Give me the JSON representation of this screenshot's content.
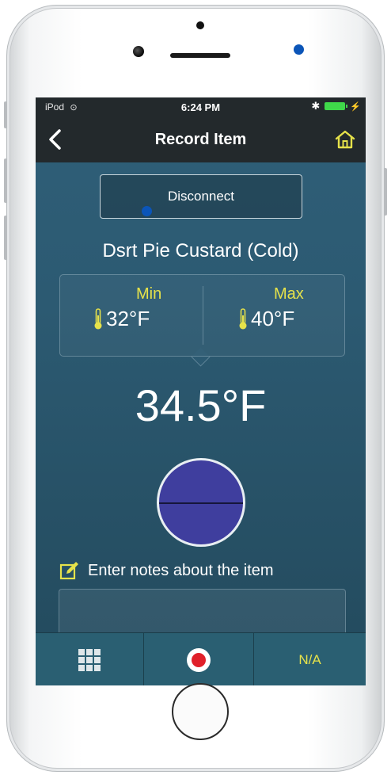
{
  "status_bar": {
    "device": "iPod",
    "time": "6:24 PM",
    "icons": [
      "wifi-icon",
      "bluetooth-icon",
      "battery-icon",
      "charging-icon"
    ]
  },
  "nav": {
    "back_icon": "chevron-left-icon",
    "title": "Record Item",
    "home_icon": "home-icon"
  },
  "disconnect_label": "Disconnect",
  "item_name": "Dsrt Pie Custard (Cold)",
  "range": {
    "min_label": "Min",
    "min_value": "32°F",
    "max_label": "Max",
    "max_value": "40°F"
  },
  "current_temp": "34.5°F",
  "notes": {
    "label": "Enter notes about the item",
    "value": ""
  },
  "bottom_bar": {
    "grid_icon": "grid-icon",
    "record_icon": "record-icon",
    "na_label": "N/A"
  },
  "colors": {
    "accent_yellow": "#e6e24a",
    "screen_bg": "#2c5a72",
    "nav_bg": "#23292c",
    "dial_fill": "#3f3e9e",
    "record_red": "#e0202a",
    "marker_blue": "#0b55b8"
  }
}
